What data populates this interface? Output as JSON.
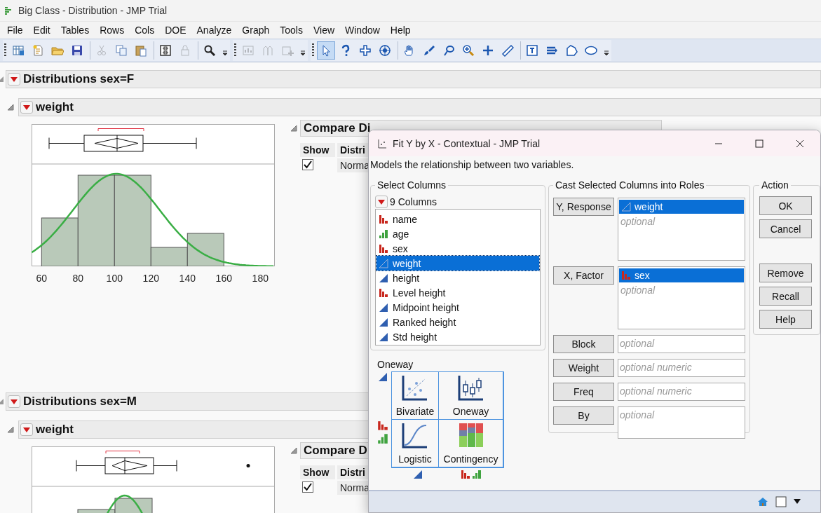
{
  "window": {
    "title": "Big Class - Distribution - JMP Trial"
  },
  "menu": [
    "File",
    "Edit",
    "Tables",
    "Rows",
    "Cols",
    "DOE",
    "Analyze",
    "Graph",
    "Tools",
    "View",
    "Window",
    "Help"
  ],
  "toolbar": [
    {
      "clusters": [
        [
          {
            "disabled": false,
            "selected": false
          },
          {
            "disabled": false,
            "selected": false
          },
          {
            "disabled": false,
            "selected": false
          },
          {
            "disabled": false,
            "selected": false
          }
        ],
        [
          {
            "disabled": true,
            "selected": false
          },
          {
            "disabled": false,
            "selected": false
          },
          {
            "disabled": false,
            "selected": false
          }
        ],
        [
          {
            "disabled": false,
            "selected": false
          },
          {
            "disabled": true,
            "selected": false
          }
        ],
        [
          {
            "disabled": false,
            "selected": false
          }
        ]
      ]
    },
    {
      "clusters": [
        [
          {
            "disabled": true,
            "selected": false
          },
          {
            "disabled": true,
            "selected": false
          },
          {
            "disabled": true,
            "selected": false
          }
        ]
      ]
    },
    {
      "clusters": [
        [
          {
            "disabled": false,
            "selected": true
          },
          {
            "disabled": false,
            "selected": false
          },
          {
            "disabled": false,
            "selected": false
          },
          {
            "disabled": false,
            "selected": false
          }
        ],
        [
          {
            "disabled": false,
            "selected": false
          },
          {
            "disabled": false,
            "selected": false
          },
          {
            "disabled": false,
            "selected": false
          },
          {
            "disabled": false,
            "selected": false
          },
          {
            "disabled": false,
            "selected": false
          },
          {
            "disabled": false,
            "selected": false
          }
        ],
        [
          {
            "disabled": false,
            "selected": false
          },
          {
            "disabled": false,
            "selected": false
          },
          {
            "disabled": false,
            "selected": false
          },
          {
            "disabled": false,
            "selected": false
          }
        ]
      ]
    }
  ],
  "sections": [
    {
      "title": "Distributions sex=F",
      "variable": {
        "title": "weight",
        "axis_ticks": [
          "60",
          "80",
          "100",
          "120",
          "140",
          "160",
          "180"
        ],
        "compare": {
          "title": "Compare Di",
          "columns": [
            "Show",
            "Distri"
          ],
          "rows": [
            {
              "checked": true,
              "label": "Norma"
            }
          ]
        }
      }
    },
    {
      "title": "Distributions sex=M",
      "variable": {
        "title": "weight",
        "compare": {
          "title": "Compare D",
          "columns": [
            "Show",
            "Distri"
          ],
          "rows": [
            {
              "checked": true,
              "label": "Norma"
            }
          ]
        }
      }
    }
  ],
  "dialog": {
    "title": "Fit Y by X - Contextual - JMP Trial",
    "description": "Models the relationship between two variables.",
    "select_columns": {
      "title": "Select Columns",
      "count": "9 Columns",
      "columns": [
        {
          "name": "name",
          "kind": "nominal",
          "selected": false
        },
        {
          "name": "age",
          "kind": "ordinal",
          "selected": false
        },
        {
          "name": "sex",
          "kind": "nominal",
          "selected": false
        },
        {
          "name": "weight",
          "kind": "continuous",
          "selected": true
        },
        {
          "name": "height",
          "kind": "continuous",
          "selected": false
        },
        {
          "name": "Level height",
          "kind": "nominal",
          "selected": false
        },
        {
          "name": "Midpoint height",
          "kind": "continuous",
          "selected": false
        },
        {
          "name": "Ranked height",
          "kind": "continuous",
          "selected": false
        },
        {
          "name": "Std height",
          "kind": "continuous",
          "selected": false
        }
      ]
    },
    "roles": {
      "title": "Cast Selected Columns into Roles",
      "roles": [
        {
          "button": "Y, Response",
          "kind": "list",
          "items": [
            {
              "name": "weight",
              "kind": "continuous",
              "selected": true
            }
          ],
          "placeholder": "optional"
        },
        {
          "button": "X, Factor",
          "kind": "list",
          "items": [
            {
              "name": "sex",
              "kind": "nominal",
              "selected": true
            }
          ],
          "placeholder": "optional"
        },
        {
          "button": "Block",
          "kind": "line",
          "placeholder": "optional"
        },
        {
          "button": "Weight",
          "kind": "line",
          "placeholder": "optional numeric"
        },
        {
          "button": "Freq",
          "kind": "line",
          "placeholder": "optional numeric"
        },
        {
          "button": "By",
          "kind": "box",
          "placeholder": "optional"
        }
      ]
    },
    "action": {
      "title": "Action",
      "buttons": [
        "OK",
        "Cancel"
      ],
      "more_buttons": [
        "Remove",
        "Recall",
        "Help"
      ]
    },
    "launch": {
      "title": "Oneway",
      "platforms": [
        {
          "label": "Bivariate",
          "kind": "bivariate"
        },
        {
          "label": "Oneway",
          "kind": "oneway"
        },
        {
          "label": "Logistic",
          "kind": "logistic"
        },
        {
          "label": "Contingency",
          "kind": "contingency"
        }
      ]
    }
  }
}
